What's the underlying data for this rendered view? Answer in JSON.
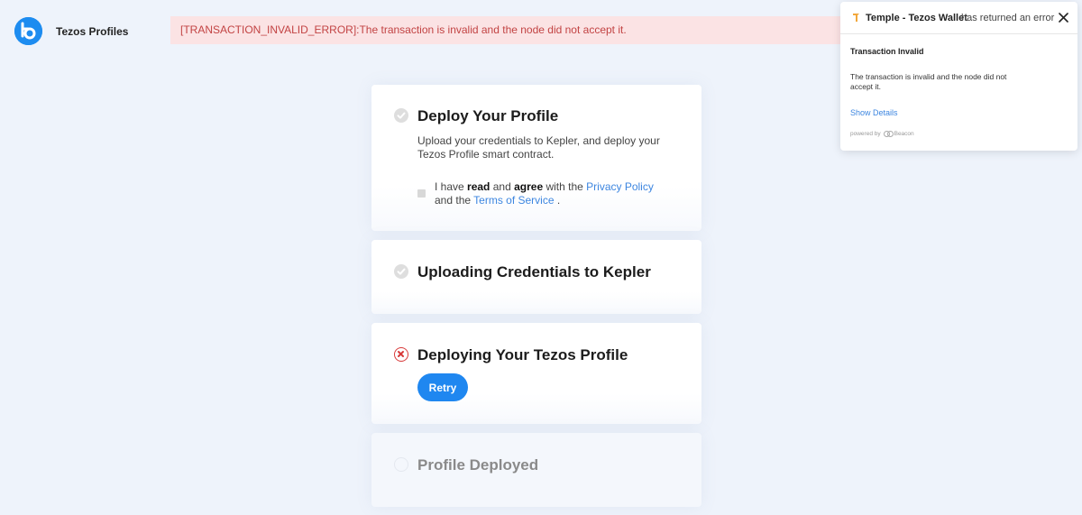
{
  "header": {
    "app_title": "Tezos Profiles",
    "logo_icon": "tezos-profiles-logo"
  },
  "banner": {
    "text": "[TRANSACTION_INVALID_ERROR]:The transaction is invalid and the node did not accept it."
  },
  "steps": [
    {
      "title": "Deploy Your Profile",
      "status": "done",
      "description": "Upload your credentials to Kepler, and deploy your Tezos Profile smart contract.",
      "consent": {
        "checked": true,
        "prefix": "I have ",
        "read": "read",
        "and1": " and ",
        "agree": "agree",
        "with_the": " with the ",
        "privacy_policy": "Privacy Policy",
        "and_the": " and the ",
        "terms": "Terms of Service",
        "suffix": " ."
      }
    },
    {
      "title": "Uploading Credentials to Kepler",
      "status": "done"
    },
    {
      "title": "Deploying Your Tezos Profile",
      "status": "error",
      "retry_label": "Retry"
    },
    {
      "title": "Profile Deployed",
      "status": "pending"
    }
  ],
  "toast": {
    "wallet_name": "Temple - Tezos Wallet",
    "message": "has returned an error",
    "title": "Transaction Invalid",
    "body": "The transaction is invalid and the node did not accept it.",
    "details_link": "Show Details",
    "powered_by": "powered by",
    "beacon": "Beacon"
  },
  "colors": {
    "accent": "#1f87f0",
    "error": "#d83a3a",
    "banner_bg": "#fbe3e4",
    "banner_text": "#c24343",
    "page_bg": "#eef3fb"
  }
}
